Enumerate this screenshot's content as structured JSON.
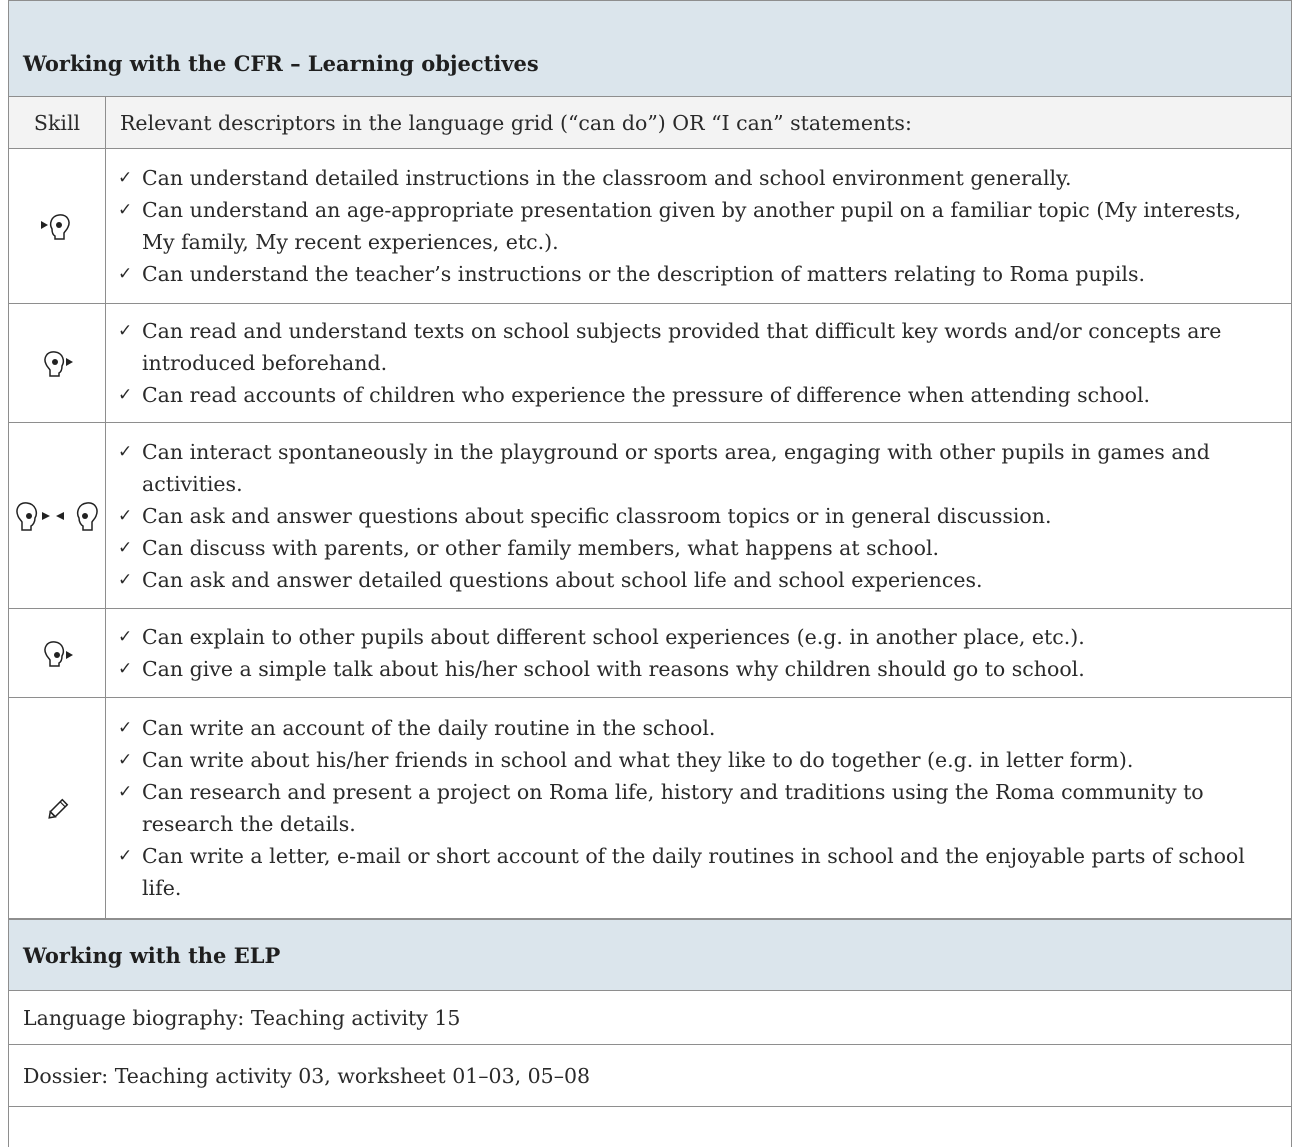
{
  "cfr": {
    "title": "Working with the CFR – Learning objectives",
    "col_skill": "Skill",
    "col_desc": "Relevant descriptors in the language grid (“can do”) OR “I can” statements:",
    "rows": [
      {
        "skill_icon": "listening-icon",
        "items": [
          "Can understand detailed instructions in the classroom and school environment generally.",
          "Can understand an age-appropriate presentation given by another pupil on a familiar topic (My interests, My family, My recent experiences, etc.).",
          "Can understand the teacher’s instructions or the description of matters relating to Roma pupils."
        ]
      },
      {
        "skill_icon": "reading-icon",
        "items": [
          "Can read and understand texts on school subjects provided that difficult key words and/or concepts are introduced beforehand.",
          "Can read accounts of children who experience the pressure of difference when attending school."
        ]
      },
      {
        "skill_icon": "spoken-interaction-icon",
        "items": [
          "Can interact spontaneously in the playground or sports area, engaging with other pupils in games and activities.",
          "Can ask and answer questions about specific classroom topics or in general discussion.",
          "Can discuss with parents, or other family members, what happens at school.",
          "Can ask and answer detailed questions about school life and school experiences."
        ]
      },
      {
        "skill_icon": "spoken-production-icon",
        "items": [
          "Can explain to other pupils about different school experiences (e.g. in another place, etc.).",
          "Can give a simple talk about his/her school with reasons why children should go to school."
        ]
      },
      {
        "skill_icon": "writing-pencil-icon",
        "items": [
          "Can write an account of the daily routine in the school.",
          "Can write about his/her friends in school and what they like to do together (e.g. in letter form).",
          "Can research and present a project on Roma life, history and traditions using the Roma community to research the details.",
          "Can write a letter, e-mail or short account of the daily routines in school and the enjoyable parts of school life."
        ]
      }
    ],
    "check_glyph": "✓"
  },
  "elp": {
    "title": "Working with the ELP",
    "biography": "Language biography:  Teaching activity 15",
    "dossier": "Dossier: Teaching activity 03, worksheet 01–03, 05–08"
  }
}
